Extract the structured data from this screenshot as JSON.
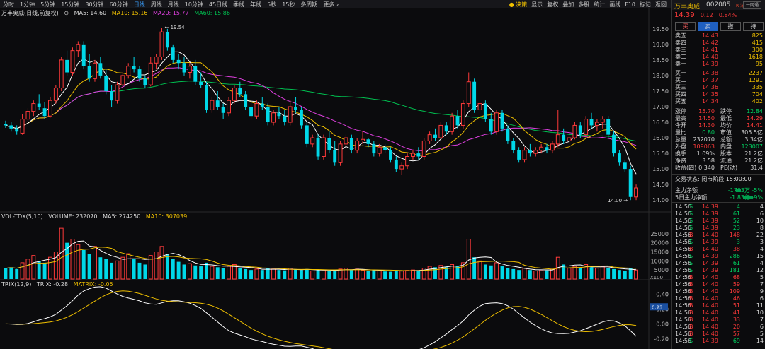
{
  "toolbar": {
    "periods": [
      "分时",
      "1分钟",
      "5分钟",
      "15分钟",
      "30分钟",
      "60分钟",
      "日线",
      "周线",
      "月线",
      "10分钟",
      "45日线",
      "季线",
      "年线",
      "5秒",
      "15秒",
      "多周期",
      "更多 ›"
    ],
    "active_index": 6,
    "right_items": [
      "决策",
      "显示",
      "复权",
      "叠加",
      "多股",
      "统计",
      "画线",
      "F10",
      "标记",
      "返回"
    ]
  },
  "price_legend": {
    "title": "万丰奥威(日线,前复权)",
    "ma5": "MA5: 14.60",
    "ma10": "MA10: 15.16",
    "ma20": "MA20: 15.77",
    "ma60": "MA60: 15.86"
  },
  "vol_legend": {
    "title": "VOL-TDX(5,10)",
    "volume": "VOLUME: 232070",
    "ma5": "MA5: 274250",
    "ma10": "MA10: 307039"
  },
  "trix_legend": {
    "title": "TRIX(12,9)",
    "trix": "TRIX: -0.28",
    "matrix": "MATRIX: -0.05"
  },
  "annotations": {
    "high": "19.54",
    "low": "14.00",
    "unit_x": "X100",
    "trix_now": "0.23"
  },
  "colors": {
    "up": "#ff3a3a",
    "down": "#00d8e8",
    "ma5": "#ffffff",
    "ma10": "#f0c000",
    "ma20": "#e040e0",
    "ma60": "#00c050",
    "bg": "#0b0b0d"
  },
  "axis": {
    "price_ticks": [
      "19.50",
      "19.00",
      "18.50",
      "18.00",
      "17.50",
      "17.00",
      "16.50",
      "16.00",
      "15.50",
      "15.00",
      "14.50",
      "14.00"
    ],
    "vol_ticks": [
      "25000",
      "20000",
      "15000",
      "10000",
      "5000"
    ],
    "trix_ticks": [
      "0.40",
      "0.20",
      "0.00",
      "-0.20"
    ]
  },
  "chart_data": {
    "type": "candlestick",
    "price_range": [
      13.8,
      19.7
    ],
    "candles": [
      [
        16.45,
        16.55,
        16.32,
        16.4
      ],
      [
        16.4,
        16.5,
        16.2,
        16.3
      ],
      [
        16.3,
        16.4,
        16.1,
        16.2
      ],
      [
        16.15,
        16.75,
        16.1,
        16.6
      ],
      [
        16.6,
        16.95,
        16.5,
        16.85
      ],
      [
        16.85,
        17.2,
        16.7,
        17.1
      ],
      [
        17.1,
        17.4,
        16.9,
        17.0
      ],
      [
        16.95,
        17.15,
        16.6,
        16.7
      ],
      [
        16.7,
        17.3,
        16.65,
        17.2
      ],
      [
        17.2,
        17.7,
        17.1,
        17.6
      ],
      [
        17.6,
        18.6,
        17.5,
        18.5
      ],
      [
        18.5,
        18.8,
        18.0,
        18.1
      ],
      [
        18.1,
        18.9,
        18.0,
        18.8
      ],
      [
        18.8,
        19.1,
        18.6,
        19.0
      ],
      [
        19.0,
        19.1,
        18.2,
        18.3
      ],
      [
        18.3,
        18.7,
        17.8,
        17.9
      ],
      [
        17.9,
        18.5,
        17.8,
        18.4
      ],
      [
        18.4,
        18.6,
        17.9,
        18.0
      ],
      [
        18.0,
        18.2,
        17.4,
        17.5
      ],
      [
        17.5,
        17.7,
        17.0,
        17.2
      ],
      [
        17.2,
        17.8,
        17.1,
        17.7
      ],
      [
        17.7,
        18.1,
        17.6,
        18.0
      ],
      [
        18.0,
        18.4,
        17.9,
        18.3
      ],
      [
        18.3,
        18.6,
        18.1,
        18.2
      ],
      [
        18.2,
        18.3,
        17.8,
        17.9
      ],
      [
        17.9,
        18.0,
        17.6,
        17.7
      ],
      [
        17.7,
        18.6,
        17.65,
        18.4
      ],
      [
        18.4,
        18.7,
        18.2,
        18.6
      ],
      [
        18.6,
        19.54,
        18.5,
        19.4
      ],
      [
        19.4,
        19.5,
        18.8,
        18.9
      ],
      [
        18.9,
        19.0,
        18.4,
        18.5
      ],
      [
        18.5,
        18.7,
        18.2,
        18.4
      ],
      [
        18.4,
        18.6,
        18.0,
        18.1
      ],
      [
        18.1,
        18.4,
        17.9,
        18.3
      ],
      [
        18.3,
        18.5,
        17.7,
        17.8
      ],
      [
        17.8,
        18.1,
        17.6,
        17.7
      ],
      [
        17.7,
        17.8,
        16.8,
        16.9
      ],
      [
        16.9,
        17.3,
        16.8,
        17.2
      ],
      [
        17.2,
        17.5,
        16.9,
        17.0
      ],
      [
        17.0,
        17.1,
        16.6,
        16.8
      ],
      [
        16.8,
        17.3,
        16.7,
        17.2
      ],
      [
        17.2,
        17.7,
        17.1,
        17.6
      ],
      [
        17.6,
        17.8,
        17.3,
        17.4
      ],
      [
        17.4,
        17.5,
        16.9,
        17.0
      ],
      [
        17.0,
        17.1,
        16.6,
        16.7
      ],
      [
        16.7,
        17.2,
        16.6,
        17.1
      ],
      [
        17.1,
        17.3,
        16.9,
        17.0
      ],
      [
        17.0,
        17.1,
        16.4,
        16.5
      ],
      [
        16.5,
        16.9,
        16.4,
        16.8
      ],
      [
        16.8,
        17.0,
        16.6,
        16.7
      ],
      [
        16.7,
        16.9,
        16.4,
        16.5
      ],
      [
        16.5,
        17.2,
        16.4,
        17.0
      ],
      [
        17.0,
        17.3,
        16.8,
        16.9
      ],
      [
        16.9,
        17.0,
        16.3,
        16.4
      ],
      [
        16.4,
        16.5,
        15.7,
        15.8
      ],
      [
        15.8,
        16.1,
        15.7,
        16.0
      ],
      [
        16.0,
        16.1,
        15.3,
        15.4
      ],
      [
        15.4,
        16.1,
        15.3,
        16.0
      ],
      [
        16.0,
        16.2,
        15.5,
        15.6
      ],
      [
        15.6,
        15.9,
        15.1,
        15.2
      ],
      [
        15.2,
        15.9,
        15.1,
        15.8
      ],
      [
        15.8,
        16.1,
        15.7,
        16.0
      ],
      [
        16.0,
        16.1,
        15.5,
        15.6
      ],
      [
        15.6,
        16.0,
        15.5,
        15.9
      ],
      [
        15.9,
        16.2,
        15.8,
        15.95
      ],
      [
        15.95,
        16.0,
        15.7,
        15.8
      ],
      [
        15.8,
        15.9,
        15.4,
        15.5
      ],
      [
        15.5,
        15.8,
        15.4,
        15.7
      ],
      [
        15.7,
        15.8,
        15.5,
        15.6
      ],
      [
        15.6,
        15.7,
        15.2,
        15.3
      ],
      [
        15.3,
        15.4,
        14.9,
        15.0
      ],
      [
        15.0,
        15.2,
        14.8,
        15.1
      ],
      [
        15.1,
        15.5,
        15.0,
        15.4
      ],
      [
        15.4,
        15.6,
        15.3,
        15.5
      ],
      [
        15.5,
        15.7,
        15.3,
        15.4
      ],
      [
        15.4,
        16.0,
        15.3,
        15.9
      ],
      [
        15.9,
        16.2,
        15.8,
        16.1
      ],
      [
        16.1,
        16.3,
        15.9,
        16.0
      ],
      [
        16.0,
        16.5,
        15.95,
        16.4
      ],
      [
        16.4,
        16.5,
        16.1,
        16.2
      ],
      [
        16.2,
        16.8,
        16.1,
        16.7
      ],
      [
        16.7,
        16.9,
        16.3,
        16.4
      ],
      [
        16.4,
        17.2,
        16.3,
        17.1
      ],
      [
        17.1,
        18.1,
        17.0,
        17.8
      ],
      [
        17.8,
        17.9,
        16.8,
        16.9
      ],
      [
        16.9,
        17.2,
        16.7,
        17.1
      ],
      [
        17.1,
        17.2,
        16.5,
        16.6
      ],
      [
        16.6,
        16.8,
        16.1,
        16.2
      ],
      [
        16.2,
        16.9,
        16.1,
        16.8
      ],
      [
        16.8,
        16.9,
        16.2,
        16.3
      ],
      [
        16.3,
        16.4,
        15.8,
        15.9
      ],
      [
        15.9,
        16.0,
        15.5,
        15.6
      ],
      [
        15.6,
        15.7,
        15.2,
        15.3
      ],
      [
        15.3,
        15.7,
        15.2,
        15.6
      ],
      [
        15.6,
        15.8,
        15.4,
        15.5
      ],
      [
        15.5,
        15.7,
        15.4,
        15.6
      ],
      [
        15.6,
        15.8,
        15.5,
        15.7
      ],
      [
        15.7,
        15.8,
        15.5,
        15.6
      ],
      [
        15.6,
        15.9,
        15.5,
        15.8
      ],
      [
        15.8,
        16.9,
        15.7,
        16.1
      ],
      [
        16.1,
        16.3,
        15.8,
        15.9
      ],
      [
        15.9,
        16.1,
        15.8,
        16.0
      ],
      [
        16.0,
        16.5,
        15.95,
        16.4
      ],
      [
        16.4,
        16.5,
        16.0,
        16.1
      ],
      [
        16.1,
        16.7,
        16.0,
        16.6
      ],
      [
        16.6,
        16.8,
        16.3,
        16.4
      ],
      [
        16.4,
        16.6,
        16.2,
        16.5
      ],
      [
        16.5,
        16.7,
        16.3,
        16.6
      ],
      [
        16.6,
        16.7,
        16.0,
        16.1
      ],
      [
        16.1,
        16.2,
        15.4,
        15.5
      ],
      [
        15.5,
        15.6,
        15.1,
        15.2
      ],
      [
        15.2,
        15.3,
        14.9,
        15.0
      ],
      [
        15.0,
        15.1,
        14.0,
        14.1
      ],
      [
        14.1,
        14.5,
        14.0,
        14.39
      ]
    ],
    "volumes": [
      6000,
      6500,
      5500,
      9000,
      11000,
      13000,
      10000,
      9000,
      12000,
      15000,
      28000,
      20000,
      22000,
      19000,
      16000,
      14000,
      18000,
      12000,
      11000,
      9000,
      10000,
      12000,
      14000,
      11000,
      9000,
      8000,
      13000,
      15000,
      18000,
      14000,
      11000,
      9500,
      8000,
      8500,
      7500,
      7000,
      9000,
      7000,
      6500,
      6000,
      7000,
      8000,
      6000,
      5500,
      5000,
      5500,
      5000,
      6000,
      5500,
      5000,
      4800,
      6000,
      5200,
      5000,
      5500,
      4500,
      5000,
      5000,
      4500,
      5000,
      5500,
      6000,
      5000,
      5500,
      4800,
      4500,
      5000,
      4500,
      4200,
      4000,
      5000,
      4500,
      4800,
      5000,
      4500,
      6000,
      7000,
      6500,
      7500,
      6500,
      8000,
      7000,
      9000,
      22000,
      12000,
      10000,
      8000,
      7500,
      9000,
      7000,
      6000,
      5500,
      5000,
      6000,
      5000,
      4500,
      5000,
      4800,
      5500,
      12000,
      8000,
      6000,
      7000,
      6000,
      8000,
      6500,
      6000,
      7000,
      6000,
      5500,
      5000,
      4500,
      6000,
      5000
    ]
  },
  "panel": {
    "header": {
      "name": "万丰奥威",
      "code": "002085",
      "tag": "R 深",
      "button": "一网通"
    },
    "price": "14.39",
    "change": "0.12",
    "pct": "0.84%",
    "buttons": [
      "买",
      "卖",
      "撤",
      "持"
    ],
    "asks": [
      [
        "卖五",
        "14.43",
        "825"
      ],
      [
        "卖四",
        "14.42",
        "415"
      ],
      [
        "卖三",
        "14.41",
        "300"
      ],
      [
        "卖二",
        "14.40",
        "1618"
      ],
      [
        "卖一",
        "14.39",
        "95"
      ]
    ],
    "bids": [
      [
        "买一",
        "14.38",
        "2237"
      ],
      [
        "买二",
        "14.37",
        "1291"
      ],
      [
        "买三",
        "14.36",
        "335"
      ],
      [
        "买四",
        "14.35",
        "704"
      ],
      [
        "买五",
        "14.34",
        "402"
      ]
    ],
    "stats": [
      [
        "涨停",
        "15.70",
        "跌停",
        "12.84"
      ],
      [
        "最高",
        "14.50",
        "最低",
        "14.29"
      ],
      [
        "今开",
        "14.30",
        "均价",
        "14.41"
      ],
      [
        "量比",
        "0.80",
        "市值",
        "305.5亿"
      ],
      [
        "总量",
        "232070",
        "总额",
        "3.34亿"
      ],
      [
        "外盘",
        "109063",
        "内盘",
        "123007"
      ],
      [
        "换手",
        "1.09%",
        "股本",
        "21.2亿"
      ],
      [
        "净资",
        "3.58",
        "流通",
        "21.2亿"
      ],
      [
        "收益(四)",
        "0.340",
        "PE(动)",
        "31.4"
      ]
    ],
    "trade_status": "交易状态: 闭市阶段 15:00:00",
    "flows": [
      [
        "主力净额",
        "-1703万",
        "-5%"
      ],
      [
        "5日主力净额",
        "-1.83亿",
        "-9%"
      ]
    ],
    "ticks": [
      [
        "14:56",
        "14.39",
        "4",
        "S",
        "4"
      ],
      [
        "14:56",
        "14.39",
        "61",
        "S",
        "6"
      ],
      [
        "14:56",
        "14.39",
        "52",
        "S",
        "10"
      ],
      [
        "14:56",
        "14.39",
        "23",
        "S",
        "8"
      ],
      [
        "14:56",
        "14.40",
        "148",
        "B",
        "22"
      ],
      [
        "14:56",
        "14.39",
        "3",
        "S",
        "3"
      ],
      [
        "14:56",
        "14.40",
        "38",
        "B",
        "4"
      ],
      [
        "14:56",
        "14.39",
        "286",
        "S",
        "15"
      ],
      [
        "14:56",
        "14.39",
        "61",
        "S",
        "4"
      ],
      [
        "14:56",
        "14.39",
        "181",
        "S",
        "12"
      ],
      [
        "14:56",
        "14.40",
        "68",
        "B",
        "5"
      ],
      [
        "14:56",
        "14.40",
        "59",
        "B",
        "7"
      ],
      [
        "14:56",
        "14.40",
        "109",
        "B",
        "9"
      ],
      [
        "14:56",
        "14.40",
        "46",
        "B",
        "6"
      ],
      [
        "14:56",
        "14.40",
        "51",
        "B",
        "11"
      ],
      [
        "14:56",
        "14.40",
        "41",
        "B",
        "10"
      ],
      [
        "14:56",
        "14.40",
        "33",
        "B",
        "7"
      ],
      [
        "14:56",
        "14.40",
        "20",
        "B",
        "6"
      ],
      [
        "14:56",
        "14.40",
        "57",
        "B",
        "5"
      ],
      [
        "14:56",
        "14.39",
        "69",
        "S",
        "14"
      ]
    ]
  }
}
